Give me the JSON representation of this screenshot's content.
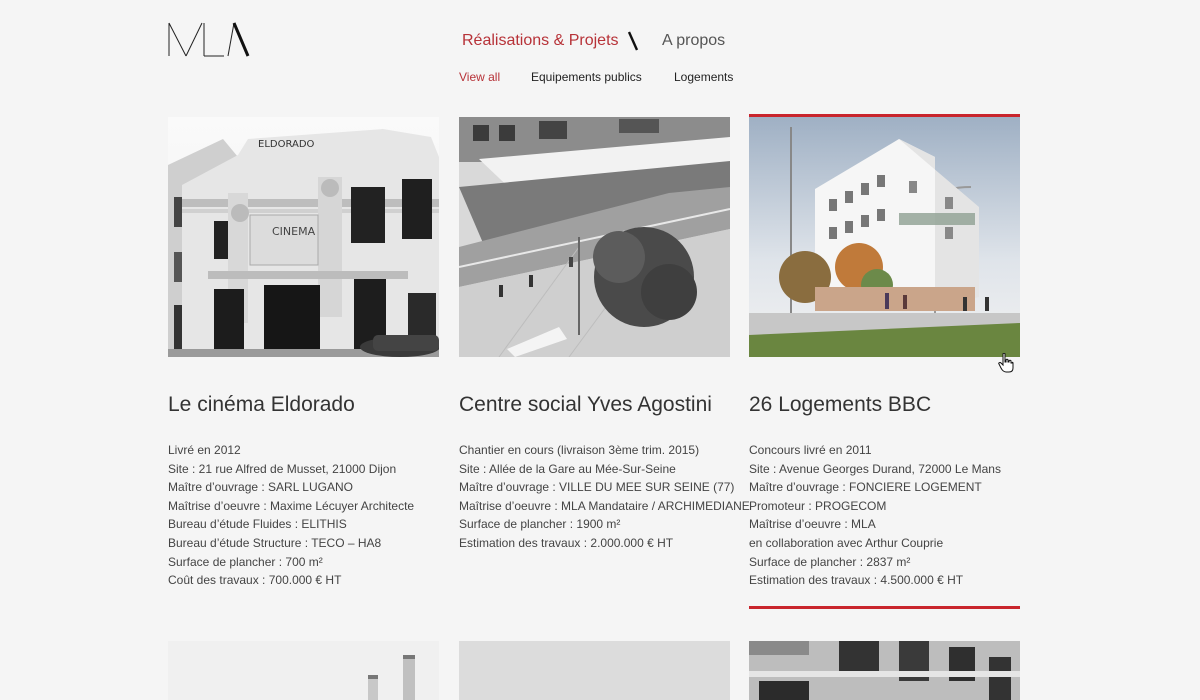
{
  "logo": {
    "text": "MLA"
  },
  "nav": {
    "projects_label": "Réalisations & Projets",
    "about_label": "A propos"
  },
  "subnav": {
    "all_label": "View all",
    "equipements_label": "Equipements publics",
    "logements_label": "Logements"
  },
  "projects": [
    {
      "title": "Le cinéma Eldorado",
      "image_sign_1": "ELDORADO",
      "image_sign_2": "CINEMA",
      "details": [
        "Livré en 2012",
        "Site : 21 rue Alfred de Musset, 21000 Dijon",
        "Maître d’ouvrage : SARL LUGANO",
        "Maîtrise d’oeuvre : Maxime Lécuyer Architecte",
        "Bureau d’étude Fluides : ELITHIS",
        "Bureau d’étude Structure : TECO – HA8",
        "Surface de plancher : 700 m²",
        "Coût des travaux : 700.000 € HT"
      ]
    },
    {
      "title": "Centre social Yves Agostini",
      "details": [
        "Chantier en cours (livraison 3ème trim. 2015)",
        "Site : Allée de la Gare au Mée-Sur-Seine",
        "Maître d’ouvrage : VILLE DU MEE SUR SEINE (77)",
        "Maîtrise d’oeuvre : MLA Mandataire / ARCHIMEDIANE",
        "Surface de plancher : 1900 m²",
        "Estimation des travaux : 2.000.000 € HT"
      ]
    },
    {
      "title": "26 Logements BBC",
      "active": true,
      "details": [
        "Concours livré en 2011",
        "Site : Avenue Georges Durand, 72000 Le Mans",
        "Maître d’ouvrage : FONCIERE LOGEMENT",
        "Promoteur : PROGECOM",
        "Maîtrise d’oeuvre : MLA",
        "en collaboration avec Arthur Couprie",
        "Surface de plancher : 2837 m²",
        "Estimation des travaux : 4.500.000 € HT"
      ]
    }
  ],
  "colors": {
    "accent": "#c9252c",
    "active_text": "#b73238",
    "background": "#f5f5f5",
    "text": "#333333"
  }
}
